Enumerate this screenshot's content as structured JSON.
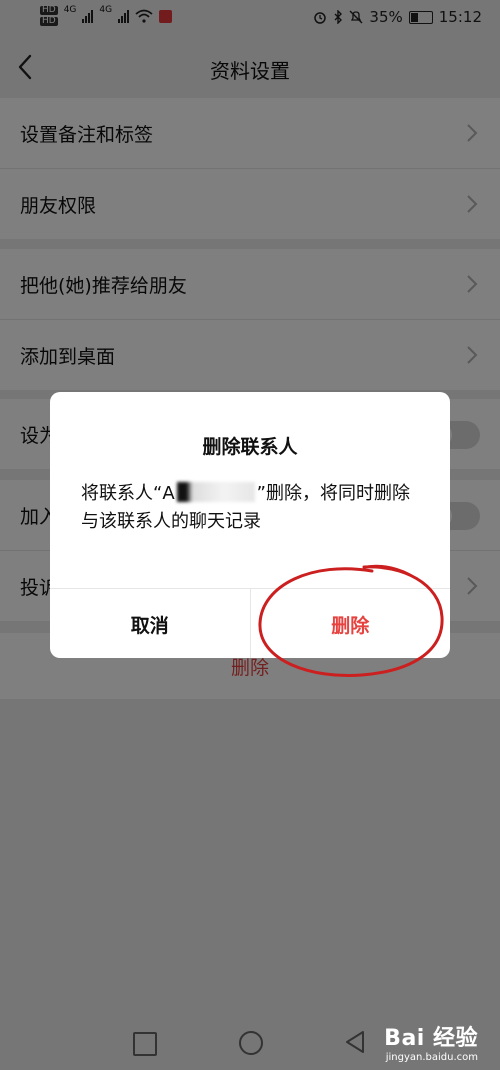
{
  "status_bar": {
    "left_hd1": "HD",
    "left_hd2": "HD",
    "net1": "4G",
    "net2": "4G",
    "battery_text": "35%",
    "time": "15:12"
  },
  "header": {
    "title": "资料设置"
  },
  "groups": {
    "g1": [
      "设置备注和标签",
      "朋友权限"
    ],
    "g2": [
      "把他(她)推荐给朋友",
      "添加到桌面"
    ],
    "g3": [
      "设为星标朋友"
    ],
    "g4": [
      "加入黑名单",
      "投诉"
    ]
  },
  "delete_row": "删除",
  "dialog": {
    "title": "删除联系人",
    "body_prefix": "将联系人“A",
    "body_suffix": "”删除，将同时删除与该联系人的聊天记录",
    "cancel_label": "取消",
    "confirm_label": "删除"
  },
  "watermark": {
    "main": "Bai 经验",
    "sub": "jingyan.baidu.com"
  },
  "colors": {
    "accent_red": "#e64340",
    "annotation_red": "#cc1f1f"
  }
}
